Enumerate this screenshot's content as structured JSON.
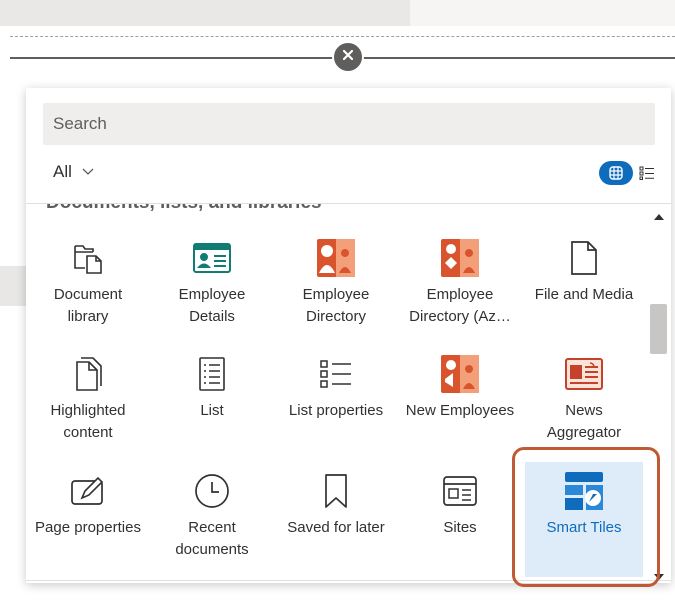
{
  "close_label": "×",
  "search": {
    "placeholder": "Search"
  },
  "filter": {
    "label": "All"
  },
  "section": {
    "title": "Documents, lists, and libraries"
  },
  "tiles": [
    {
      "label": "Document library",
      "icon": "document-library-icon"
    },
    {
      "label": "Employee Details",
      "icon": "employee-details-icon"
    },
    {
      "label": "Employee Directory",
      "icon": "employee-directory-icon"
    },
    {
      "label": "Employee Directory (Az…",
      "icon": "employee-directory-azure-icon"
    },
    {
      "label": "File and Media",
      "icon": "file-icon"
    },
    {
      "label": "Highlighted content",
      "icon": "highlighted-content-icon"
    },
    {
      "label": "List",
      "icon": "list-icon"
    },
    {
      "label": "List properties",
      "icon": "list-properties-icon"
    },
    {
      "label": "New Employees",
      "icon": "new-employees-icon"
    },
    {
      "label": "News Aggregator",
      "icon": "news-aggregator-icon"
    },
    {
      "label": "Page properties",
      "icon": "page-properties-icon"
    },
    {
      "label": "Recent documents",
      "icon": "clock-icon"
    },
    {
      "label": "Saved for later",
      "icon": "bookmark-icon"
    },
    {
      "label": "Sites",
      "icon": "sites-icon"
    },
    {
      "label": "Smart Tiles",
      "icon": "smart-tiles-icon",
      "selected": true
    }
  ],
  "colors": {
    "accent": "#0f6cbd",
    "selected_bg": "#deecf9",
    "highlight": "#bf5a35",
    "app_orange": "#d9542c"
  }
}
